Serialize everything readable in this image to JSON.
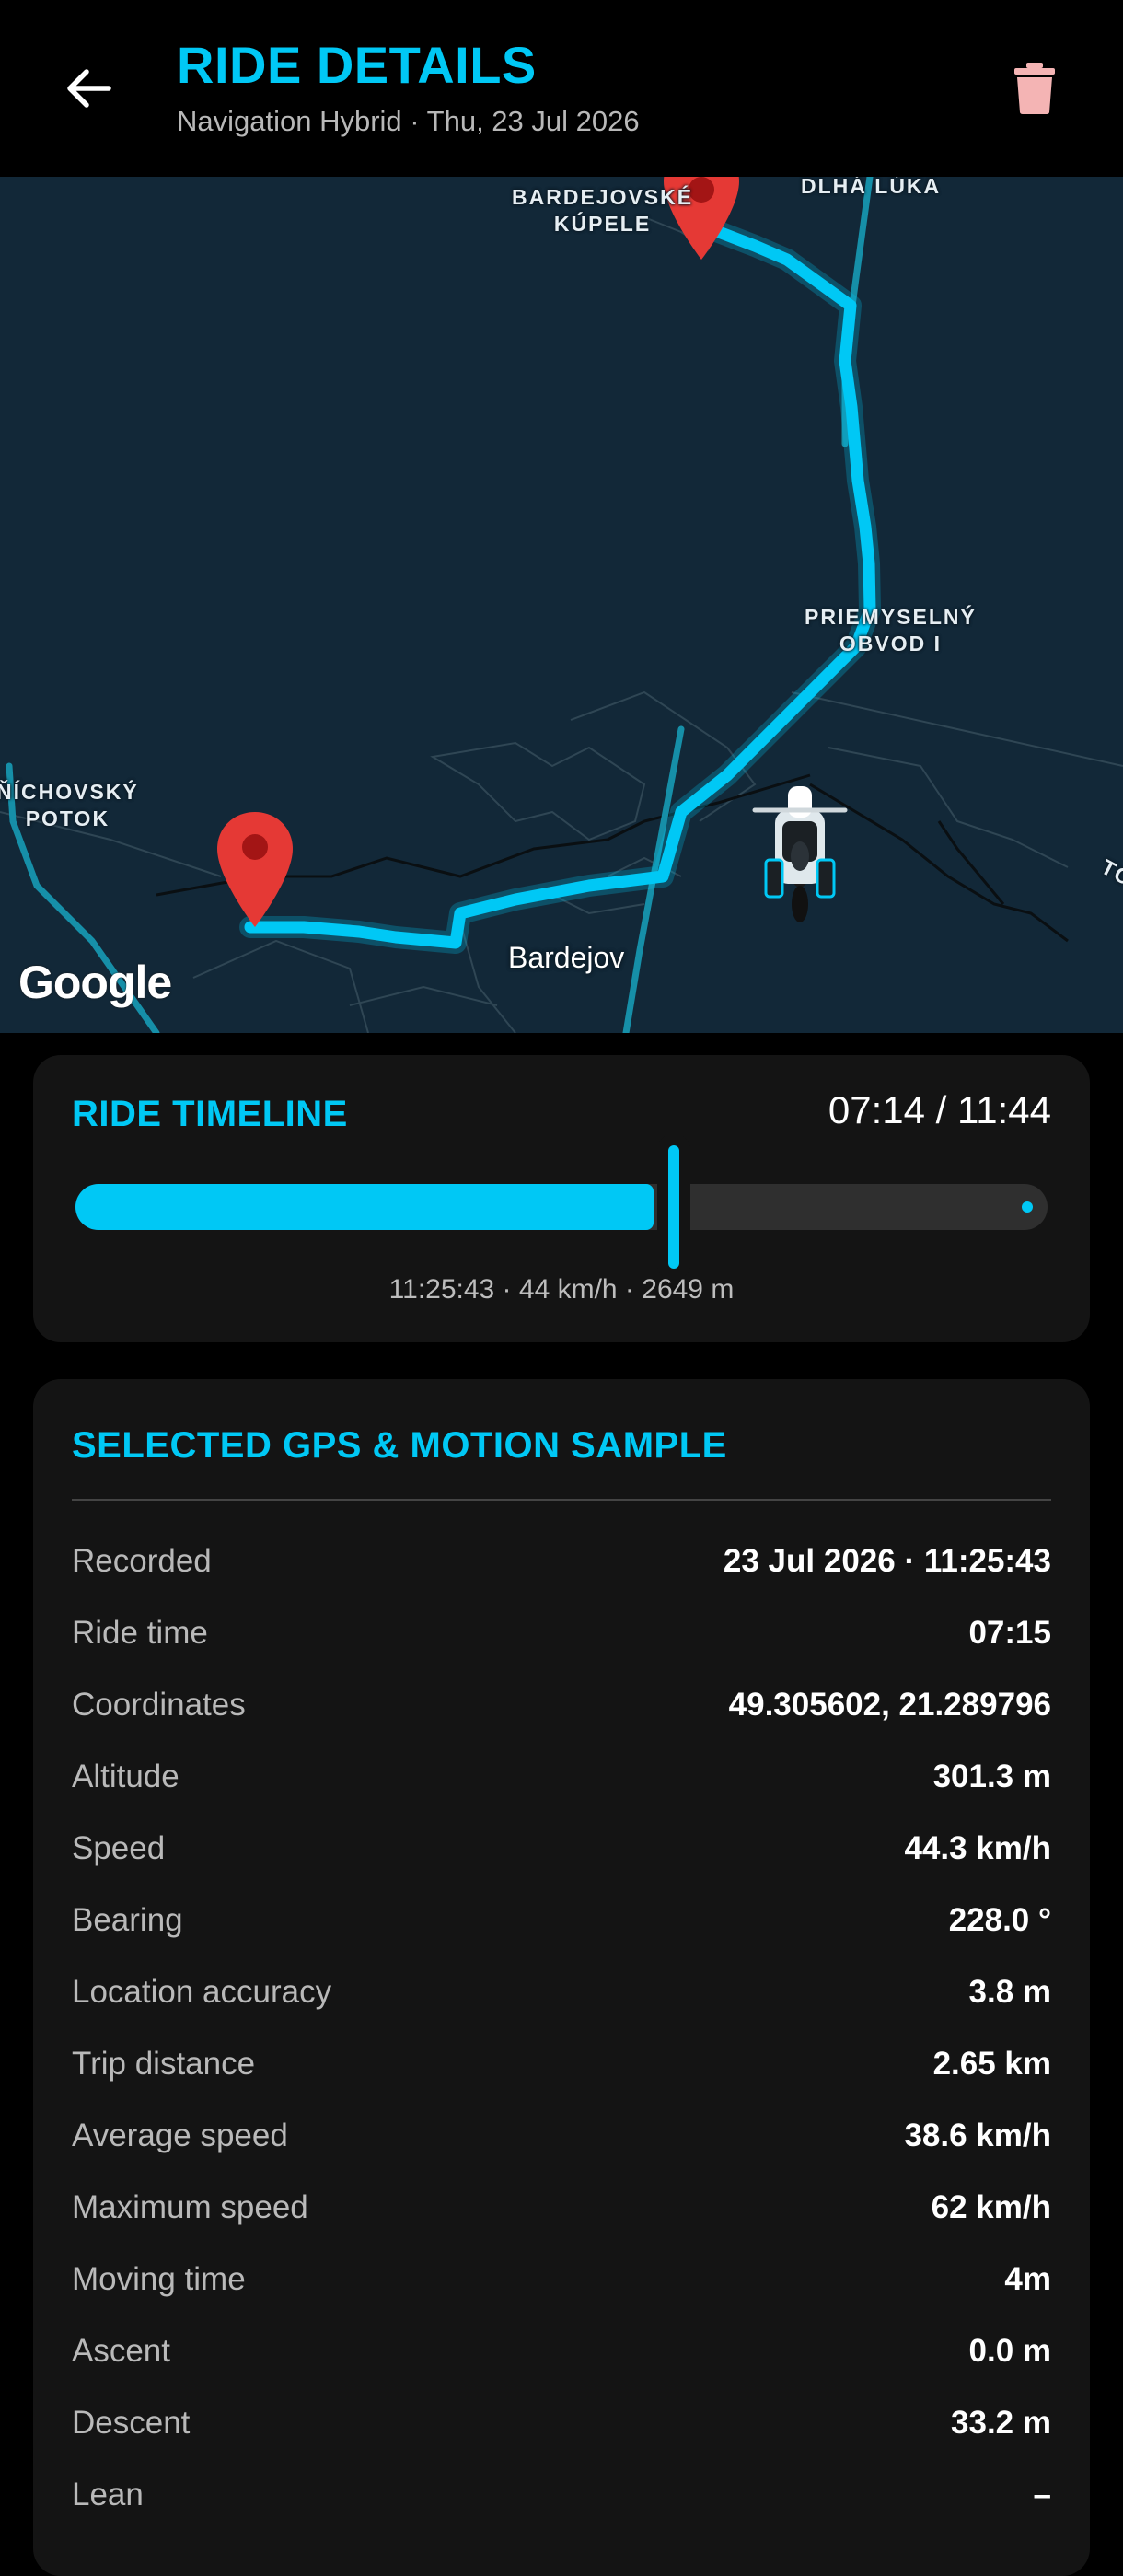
{
  "header": {
    "title": "RIDE DETAILS",
    "subtitle": "Navigation Hybrid · Thu, 23 Jul 2026",
    "back_icon": "arrow-left-icon",
    "delete_icon": "trash-icon",
    "delete_icon_color": "#f4b4b4"
  },
  "map": {
    "labels": {
      "bardejovske_kupele": "BARDEJOVSKÉ\nKÚPELE",
      "dlha_luka": "DLHÁ LÚKA",
      "priemyselny_obvod": "PRIEMYSELNÝ\nOBVOD I",
      "snichovsky_potok": "ŇÍCHOVSKÝ\nPOTOK",
      "city": "Bardejov",
      "edge_label": "TO"
    },
    "attribution": "Google",
    "route_color": "#00c8f5",
    "marker_color": "#e53935"
  },
  "timeline": {
    "title": "RIDE TIMELINE",
    "time": "07:14 / 11:44",
    "progress": 0.616,
    "caption": "11:25:43 · 44 km/h · 2649 m"
  },
  "sample": {
    "title": "SELECTED GPS & MOTION SAMPLE",
    "rows": [
      {
        "label": "Recorded",
        "value": "23 Jul 2026 · 11:25:43"
      },
      {
        "label": "Ride time",
        "value": "07:15"
      },
      {
        "label": "Coordinates",
        "value": "49.305602, 21.289796"
      },
      {
        "label": "Altitude",
        "value": "301.3 m"
      },
      {
        "label": "Speed",
        "value": "44.3 km/h"
      },
      {
        "label": "Bearing",
        "value": "228.0 °"
      },
      {
        "label": "Location accuracy",
        "value": "3.8 m"
      },
      {
        "label": "Trip distance",
        "value": "2.65 km"
      },
      {
        "label": "Average speed",
        "value": "38.6 km/h"
      },
      {
        "label": "Maximum speed",
        "value": "62 km/h"
      },
      {
        "label": "Moving time",
        "value": "4m"
      },
      {
        "label": "Ascent",
        "value": "0.0 m"
      },
      {
        "label": "Descent",
        "value": "33.2 m"
      },
      {
        "label": "Lean",
        "value": "–"
      }
    ]
  }
}
